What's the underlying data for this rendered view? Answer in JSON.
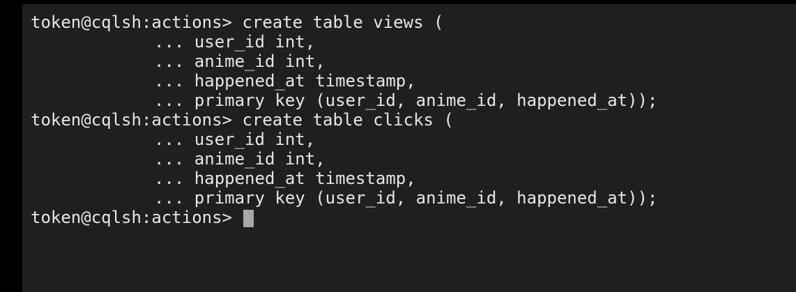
{
  "terminal": {
    "prompt": "token@cqlsh:actions> ",
    "continuation": "... ",
    "lines": [
      {
        "kind": "prompt",
        "text": "create table views ("
      },
      {
        "kind": "continuation",
        "text": "user_id int,"
      },
      {
        "kind": "continuation",
        "text": "anime_id int,"
      },
      {
        "kind": "continuation",
        "text": "happened_at timestamp,"
      },
      {
        "kind": "continuation",
        "text": "primary key (user_id, anime_id, happened_at));"
      },
      {
        "kind": "prompt",
        "text": "create table clicks ("
      },
      {
        "kind": "continuation",
        "text": "user_id int,"
      },
      {
        "kind": "continuation",
        "text": "anime_id int,"
      },
      {
        "kind": "continuation",
        "text": "happened_at timestamp,"
      },
      {
        "kind": "continuation",
        "text": "primary key (user_id, anime_id, happened_at));"
      },
      {
        "kind": "prompt",
        "text": ""
      }
    ],
    "colors": {
      "background": "#1f1f1f",
      "foreground": "#e6e6e6",
      "cursor": "#a8a8a8",
      "frame": "#000000"
    }
  }
}
